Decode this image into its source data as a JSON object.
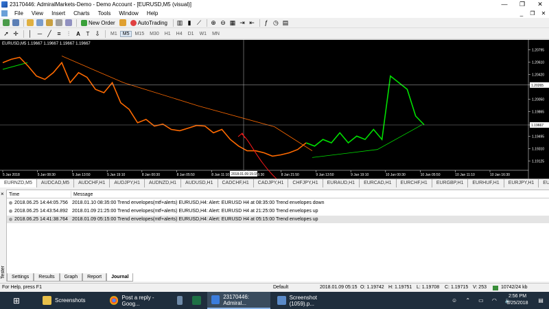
{
  "window": {
    "title": "23170446: AdmiralMarkets-Demo - Demo Account - [EURUSD,M5 (visual)]",
    "minimize": "—",
    "restore": "❐",
    "close": "✕"
  },
  "menu": [
    "File",
    "View",
    "Insert",
    "Charts",
    "Tools",
    "Window",
    "Help"
  ],
  "mdi_controls": {
    "minimize": "_",
    "restore": "❐",
    "close": "✕"
  },
  "toolbar1": {
    "new_order": "New Order",
    "auto_trading": "AutoTrading"
  },
  "timeframes": [
    "M1",
    "M5",
    "M15",
    "M30",
    "H1",
    "H4",
    "D1",
    "W1",
    "MN"
  ],
  "active_timeframe": "M5",
  "chart": {
    "info_label": "EURUSD,M5  1.19667 1.19667 1.19667 1.19667",
    "crosshair_time": "2018.01.09 15:15",
    "crosshair_price": "1.20265",
    "current_price": "1.19667",
    "colors": {
      "bear": "#ff6a00",
      "bull": "#00e000",
      "envelope": "#ff6a00",
      "envelope_bull": "#00e000",
      "annotation": "#ff1a1a",
      "background": "#000000"
    }
  },
  "chart_data": {
    "type": "line",
    "title": "EURUSD,M5",
    "price_axis_ticks": [
      "1.20795",
      "1.20610",
      "1.20420",
      "1.20265",
      "1.20050",
      "1.19865",
      "1.19667",
      "1.19495",
      "1.19310",
      "1.19125"
    ],
    "time_axis_ticks": [
      "5 Jan 2018",
      "5 Jan 08:30",
      "5 Jan 13:50",
      "5 Jan 19:10",
      "8 Jan 00:30",
      "8 Jan 05:50",
      "8 Jan 11:10",
      "8 Jan 16:30",
      "8 Jan 21:50",
      "9 Jan 13:50",
      "9 Jan 19:10",
      "10 Jan 00:30",
      "10 Jan 05:50",
      "10 Jan 11:10",
      "10 Jan 16:30"
    ],
    "series": [
      {
        "name": "EURUSD",
        "values": [
          1.206,
          1.2065,
          1.2068,
          1.2055,
          1.204,
          1.2035,
          1.2045,
          1.206,
          1.203,
          1.2045,
          1.2038,
          1.202,
          1.2015,
          1.203,
          1.2,
          1.199,
          1.197,
          1.1975,
          1.1965,
          1.1968,
          1.196,
          1.1958,
          1.1962,
          1.1966,
          1.1965,
          1.1955,
          1.196,
          1.1945,
          1.1935,
          1.1928,
          1.1928,
          1.1925,
          1.192,
          1.1922,
          1.1925,
          1.193,
          1.194,
          1.1935,
          1.1945,
          1.194,
          1.1955,
          1.194,
          1.195,
          1.1945,
          1.196,
          1.1945,
          1.204,
          1.203,
          1.202,
          1.198,
          1.1967
        ]
      }
    ]
  },
  "symbol_tabs": [
    "EURNZD,M5",
    "AUDCAD,M5",
    "AUDCHF,H1",
    "AUDJPY,H1",
    "AUDNZD,H1",
    "AUDUSD,H1",
    "CADCHF,H1",
    "CADJPY,H1",
    "CHFJPY,H1",
    "EURAUD,H1",
    "EURCAD,H1",
    "EURCHF,H1",
    "EURGBP,H1",
    "EURHUF,H1",
    "EURJPY,H1",
    "EURN"
  ],
  "terminal": {
    "side_label": "Tester",
    "close": "×",
    "columns": {
      "time": "Time",
      "message": "Message"
    },
    "rows": [
      {
        "time": "2018.06.25 14:44:05.756",
        "message": "2018.01.10 08:35:00  Trend envelopes(mtf+alerts) EURUSD,H4: Alert: EURUSD H4 at 08:35:00 Trend envelopes down"
      },
      {
        "time": "2018.06.25 14:43:54.892",
        "message": "2018.01.09 21:25:00  Trend envelopes(mtf+alerts) EURUSD,H4: Alert: EURUSD H4 at 21:25:00 Trend envelopes up"
      },
      {
        "time": "2018.06.25 14:41:38.764",
        "message": "2018.01.09 05:15:00  Trend envelopes(mtf+alerts) EURUSD,H4: Alert: EURUSD H4 at 05:15:00 Trend envelopes up"
      }
    ],
    "tabs": [
      "Settings",
      "Results",
      "Graph",
      "Report",
      "Journal"
    ],
    "active_tab": "Journal"
  },
  "status": {
    "help": "For Help, press F1",
    "profile": "Default",
    "time": "2018.01.09 05:15",
    "open": "O: 1.19742",
    "high": "H: 1.19751",
    "low": "L: 1.19708",
    "close": "C: 1.19715",
    "volume": "V: 253",
    "traffic": "10742/24 kb"
  },
  "taskbar": {
    "items": [
      "Screenshots",
      "Post a reply - Goog...",
      "23170446: Admiral...",
      "Screenshot (1059).p..."
    ],
    "clock_time": "2:56 PM",
    "clock_date": "6/25/2018"
  }
}
